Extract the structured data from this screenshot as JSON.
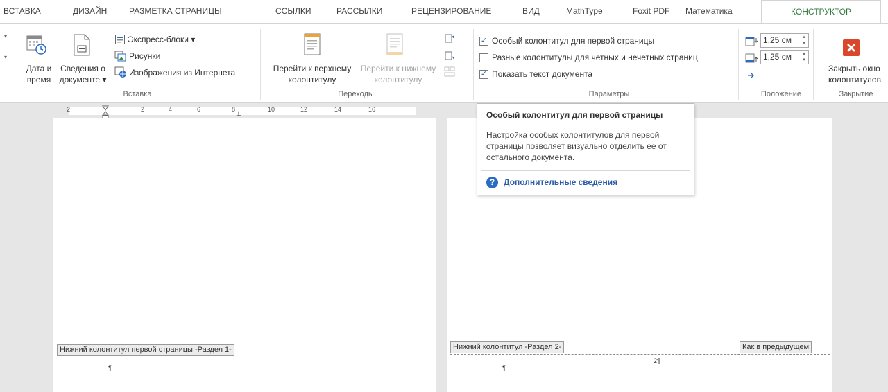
{
  "tabs": [
    {
      "label": "ВСТАВКА"
    },
    {
      "label": "ДИЗАЙН"
    },
    {
      "label": "РАЗМЕТКА СТРАНИЦЫ"
    },
    {
      "label": "ССЫЛКИ"
    },
    {
      "label": "РАССЫЛКИ"
    },
    {
      "label": "РЕЦЕНЗИРОВАНИЕ"
    },
    {
      "label": "ВИД"
    },
    {
      "label": "MathType"
    },
    {
      "label": "Foxit PDF"
    },
    {
      "label": "Математика"
    },
    {
      "label": "КОНСТРУКТОР"
    }
  ],
  "ribbon": {
    "insert_group": {
      "datetime_line1": "Дата и",
      "datetime_line2": "время",
      "docinfo_line1": "Сведения о",
      "docinfo_line2": "документе ▾",
      "quickparts": "Экспресс-блоки ▾",
      "pictures": "Рисунки",
      "online_pictures": "Изображения из Интернета",
      "label": "Вставка"
    },
    "nav_group": {
      "goto_header_line1": "Перейти к верхнему",
      "goto_header_line2": "колонтитулу",
      "goto_footer_line1": "Перейти к нижнему",
      "goto_footer_line2": "колонтитулу",
      "label": "Переходы"
    },
    "options_group": {
      "diff_first_page": "Особый колонтитул для первой страницы",
      "diff_odd_even": "Разные колонтитулы для четных и нечетных страниц",
      "show_doc_text": "Показать текст документа",
      "label": "Параметры"
    },
    "position_group": {
      "header_from_top": "1,25 см",
      "footer_from_bottom": "1,25 см",
      "label": "Положение"
    },
    "close_group": {
      "close_line1": "Закрыть окно",
      "close_line2": "колонтитулов",
      "label": "Закрытие"
    }
  },
  "ruler": {
    "numbers": [
      "2",
      "2",
      "4",
      "6",
      "8",
      "10",
      "12",
      "14",
      "16"
    ]
  },
  "tooltip": {
    "title": "Особый колонтитул для первой страницы",
    "body": "Настройка особых колонтитулов для первой страницы позволяет визуально отделить ее от остального документа.",
    "link": "Дополнительные сведения"
  },
  "pages": {
    "left_footer_tag": "Нижний колонтитул первой страницы -Раздел 1-",
    "right_footer_tag": "Нижний колонтитул -Раздел 2-",
    "right_same_as_prev": "Как в предыдущем",
    "pilcrow": "¶",
    "page_number": "2¶"
  },
  "colors": {
    "active_tab": "#2b7a3b",
    "close_icon": "#d9482b",
    "link": "#2a5aa8"
  }
}
